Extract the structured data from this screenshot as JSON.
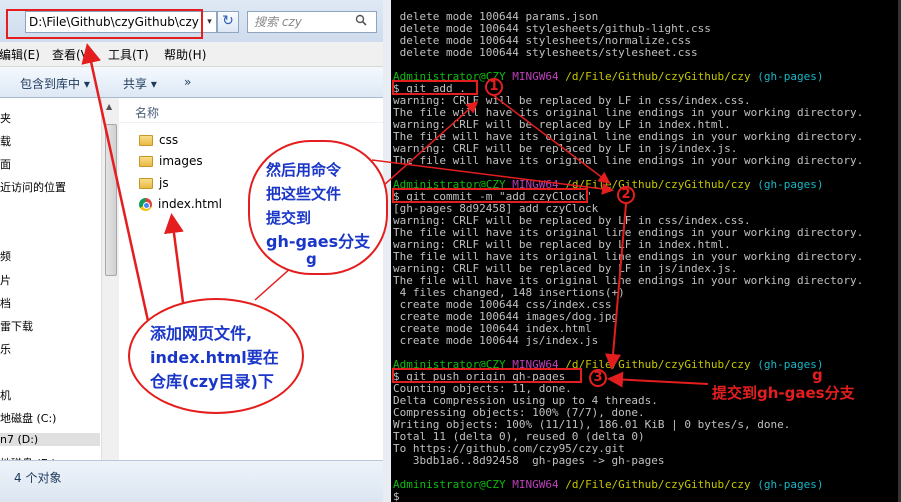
{
  "explorer": {
    "address": "D:\\File\\Github\\czyGithub\\czy",
    "address_dropdown_glyph": "▾",
    "refresh_glyph": "↻",
    "search_placeholder": "搜索 czy",
    "search_icon": "magnifier-icon",
    "menu": [
      "编辑(E)",
      "查看(V)",
      "工具(T)",
      "帮助(H)"
    ],
    "toolbar": [
      "包含到库中 ▾",
      "共享 ▾",
      "»"
    ],
    "nav_items": [
      "夹",
      "载",
      "面",
      "近访问的位置",
      "频",
      "片",
      "档",
      "雷下载",
      "乐",
      "机",
      "地磁盘 (C:)",
      "n7 (D:)",
      "地磁盘 (E:)"
    ],
    "column_header": "名称",
    "files": [
      {
        "name": "css",
        "icon": "folder-icon"
      },
      {
        "name": "images",
        "icon": "folder-icon"
      },
      {
        "name": "js",
        "icon": "folder-icon"
      },
      {
        "name": "index.html",
        "icon": "chrome-file-icon"
      }
    ],
    "status": "4 个对象"
  },
  "terminal": {
    "lines": [
      {
        "text": " delete mode 100644 params.json"
      },
      {
        "text": " delete mode 100644 stylesheets/github-light.css"
      },
      {
        "text": " delete mode 100644 stylesheets/normalize.css"
      },
      {
        "text": " delete mode 100644 stylesheets/stylesheet.css"
      },
      {
        "text": ""
      },
      {
        "prompt": {
          "user": "Administrator@CZY",
          "host": "MINGW64",
          "path": "/d/File/Github/czyGithub/czy",
          "branch": "(gh-pages)"
        }
      },
      {
        "text": "$ git add ."
      },
      {
        "text": "warning: CRLF will be replaced by LF in css/index.css."
      },
      {
        "text": "The file will have its original line endings in your working directory."
      },
      {
        "text": "warning: CRLF will be replaced by LF in index.html."
      },
      {
        "text": "The file will have its original line endings in your working directory."
      },
      {
        "text": "warning: CRLF will be replaced by LF in js/index.js."
      },
      {
        "text": "The file will have its original line endings in your working directory."
      },
      {
        "text": ""
      },
      {
        "prompt": {
          "user": "Administrator@CZY",
          "host": "MINGW64",
          "path": "/d/File/Github/czyGithub/czy",
          "branch": "(gh-pages)"
        }
      },
      {
        "text": "$ git commit -m \"add czyClock\""
      },
      {
        "text": "[gh-pages 8d92458] add czyClock"
      },
      {
        "text": "warning: CRLF will be replaced by LF in css/index.css."
      },
      {
        "text": "The file will have its original line endings in your working directory."
      },
      {
        "text": "warning: CRLF will be replaced by LF in index.html."
      },
      {
        "text": "The file will have its original line endings in your working directory."
      },
      {
        "text": "warning: CRLF will be replaced by LF in js/index.js."
      },
      {
        "text": "The file will have its original line endings in your working directory."
      },
      {
        "text": " 4 files changed, 148 insertions(+)"
      },
      {
        "text": " create mode 100644 css/index.css"
      },
      {
        "text": " create mode 100644 images/dog.jpg"
      },
      {
        "text": " create mode 100644 index.html"
      },
      {
        "text": " create mode 100644 js/index.js"
      },
      {
        "text": ""
      },
      {
        "prompt": {
          "user": "Administrator@CZY",
          "host": "MINGW64",
          "path": "/d/File/Github/czyGithub/czy",
          "branch": "(gh-pages)"
        }
      },
      {
        "text": "$ git push origin gh-pages"
      },
      {
        "text": "Counting objects: 11, done."
      },
      {
        "text": "Delta compression using up to 4 threads."
      },
      {
        "text": "Compressing objects: 100% (7/7), done."
      },
      {
        "text": "Writing objects: 100% (11/11), 186.01 KiB | 0 bytes/s, done."
      },
      {
        "text": "Total 11 (delta 0), reused 0 (delta 0)"
      },
      {
        "text": "To https://github.com/czy95/czy.git"
      },
      {
        "text": "   3bdb1a6..8d92458  gh-pages -> gh-pages"
      },
      {
        "text": ""
      },
      {
        "prompt": {
          "user": "Administrator@CZY",
          "host": "MINGW64",
          "path": "/d/File/Github/czyGithub/czy",
          "branch": "(gh-pages)"
        }
      },
      {
        "text": "$"
      }
    ]
  },
  "annotations": {
    "step_numbers": [
      "1",
      "2",
      "3"
    ],
    "bubble_left": [
      "添加网页文件,",
      "index.html要在",
      "仓库(czy目录)下"
    ],
    "bubble_middle": [
      "然后用命令",
      "把这些文件",
      "提交到",
      "gh-gaes分支",
      "g"
    ],
    "right_note": "提交到gh-gaes分支",
    "right_note_extra": "g",
    "accent_color": "#e41e1e",
    "bubble_text_color": "#1a36c8"
  }
}
